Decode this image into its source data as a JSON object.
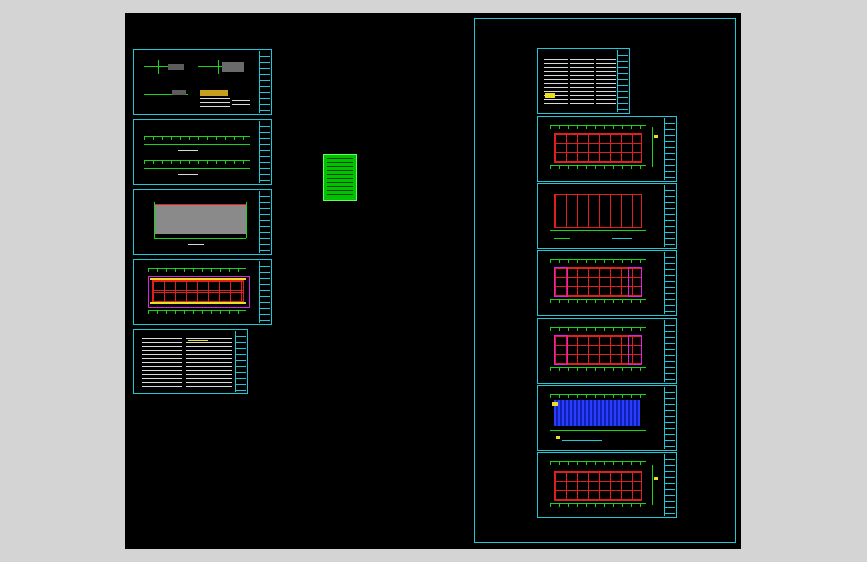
{
  "app": {
    "background_color": "#d4d4d4",
    "canvas_color": "#000000",
    "frame_color": "#1fc8d8"
  },
  "model_space": {
    "left_group": {
      "sheets": [
        {
          "kind": "section-details"
        },
        {
          "kind": "elevations"
        },
        {
          "kind": "foundation-plan"
        },
        {
          "kind": "floor-plan"
        },
        {
          "kind": "notes-table"
        }
      ]
    },
    "legend": {
      "kind": "color-layer-table",
      "color": "#00c000"
    },
    "right_group": {
      "sheets": [
        {
          "kind": "design-notes"
        },
        {
          "kind": "roof-framing-plan"
        },
        {
          "kind": "column-layout-plan"
        },
        {
          "kind": "bracing-plan-1"
        },
        {
          "kind": "bracing-plan-2"
        },
        {
          "kind": "purlin-layout"
        },
        {
          "kind": "wall-framing"
        }
      ]
    }
  }
}
